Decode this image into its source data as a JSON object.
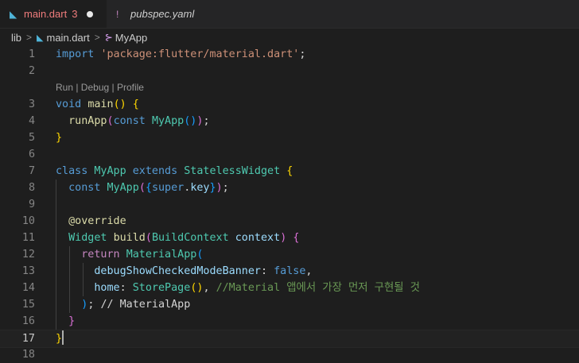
{
  "tabs": [
    {
      "label": "main.dart",
      "problems": "3",
      "icon": "dart-file-icon",
      "dirty": true,
      "active": true
    },
    {
      "label": "pubspec.yaml",
      "icon": "yaml-file-icon",
      "glyph": "!",
      "active": false
    }
  ],
  "breadcrumb": {
    "folder": "lib",
    "file": "main.dart",
    "symbol": "MyApp"
  },
  "codelens": "Run | Debug | Profile",
  "lines": [
    {
      "n": "1",
      "tokens": [
        [
          "import ",
          "k"
        ],
        [
          "'package:flutter/material.dart'",
          "s"
        ],
        [
          ";",
          "p"
        ]
      ]
    },
    {
      "n": "2",
      "tokens": []
    },
    {
      "n": "3",
      "tokens": [
        [
          "void ",
          "k"
        ],
        [
          "main",
          "f"
        ],
        [
          "() ",
          "b1"
        ],
        [
          "{",
          "b1"
        ]
      ]
    },
    {
      "n": "4",
      "tokens": [
        [
          "  ",
          "p"
        ],
        [
          "runApp",
          "f"
        ],
        [
          "(",
          "b2"
        ],
        [
          "const ",
          "k"
        ],
        [
          "MyApp",
          "t"
        ],
        [
          "()",
          "b3"
        ],
        [
          ")",
          "b2"
        ],
        [
          ";",
          "p"
        ]
      ]
    },
    {
      "n": "5",
      "tokens": [
        [
          "}",
          "b1"
        ]
      ]
    },
    {
      "n": "6",
      "tokens": []
    },
    {
      "n": "7",
      "tokens": [
        [
          "class ",
          "k"
        ],
        [
          "MyApp ",
          "t"
        ],
        [
          "extends ",
          "k"
        ],
        [
          "StatelessWidget ",
          "t"
        ],
        [
          "{",
          "b1"
        ]
      ]
    },
    {
      "n": "8",
      "tokens": [
        [
          "  ",
          "p"
        ],
        [
          "const ",
          "k"
        ],
        [
          "MyApp",
          "t"
        ],
        [
          "(",
          "b2"
        ],
        [
          "{",
          "b3"
        ],
        [
          "super",
          "k"
        ],
        [
          ".",
          "p"
        ],
        [
          "key",
          "v"
        ],
        [
          "}",
          "b3"
        ],
        [
          ")",
          "b2"
        ],
        [
          ";",
          "p"
        ]
      ]
    },
    {
      "n": "9",
      "tokens": []
    },
    {
      "n": "10",
      "tokens": [
        [
          "  ",
          "p"
        ],
        [
          "@override",
          "f"
        ]
      ]
    },
    {
      "n": "11",
      "tokens": [
        [
          "  ",
          "p"
        ],
        [
          "Widget ",
          "t"
        ],
        [
          "build",
          "f"
        ],
        [
          "(",
          "b2"
        ],
        [
          "BuildContext ",
          "t"
        ],
        [
          "context",
          "v"
        ],
        [
          ") ",
          "b2"
        ],
        [
          "{",
          "b2"
        ]
      ]
    },
    {
      "n": "12",
      "tokens": [
        [
          "    ",
          "p"
        ],
        [
          "return ",
          "ctl"
        ],
        [
          "MaterialApp",
          "t"
        ],
        [
          "(",
          "b3"
        ]
      ]
    },
    {
      "n": "13",
      "tokens": [
        [
          "      ",
          "p"
        ],
        [
          "debugShowCheckedModeBanner",
          "v"
        ],
        [
          ": ",
          "p"
        ],
        [
          "false",
          "k"
        ],
        [
          ",",
          "p"
        ]
      ]
    },
    {
      "n": "14",
      "tokens": [
        [
          "      ",
          "p"
        ],
        [
          "home",
          "v"
        ],
        [
          ": ",
          "p"
        ],
        [
          "StorePage",
          "t"
        ],
        [
          "()",
          "b1"
        ],
        [
          ", ",
          "p"
        ],
        [
          "//Material 앱에서 가장 먼저 구현될 것",
          "c"
        ]
      ]
    },
    {
      "n": "15",
      "tokens": [
        [
          "    ",
          "p"
        ],
        [
          ")",
          "b3"
        ],
        [
          "; ",
          "p"
        ],
        [
          "// MaterialApp",
          "p"
        ]
      ]
    },
    {
      "n": "16",
      "tokens": [
        [
          "  ",
          "p"
        ],
        [
          "}",
          "b2"
        ]
      ]
    },
    {
      "n": "17",
      "tokens": [
        [
          "}",
          "b1"
        ]
      ]
    },
    {
      "n": "18",
      "tokens": []
    }
  ]
}
